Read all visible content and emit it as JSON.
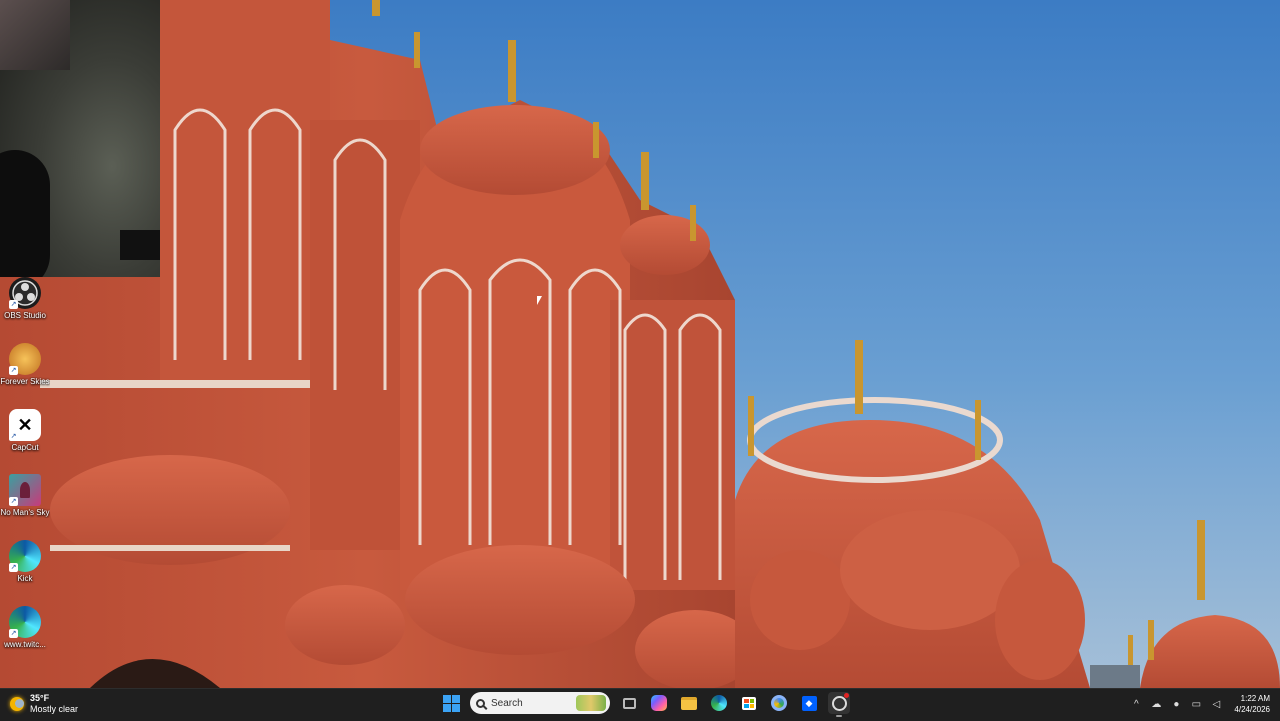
{
  "desktop": {
    "icons": [
      {
        "label": "OBS Studio",
        "icon": "obs-icon",
        "color": "#2b2b2b"
      },
      {
        "label": "Forever Skies",
        "icon": "forever-skies-icon",
        "color": "#e0a23a"
      },
      {
        "label": "CapCut",
        "icon": "capcut-icon",
        "color": "#ffffff"
      },
      {
        "label": "No Man's Sky",
        "icon": "no-mans-sky-icon",
        "color": "#c83a7a"
      },
      {
        "label": "Kick",
        "icon": "edge-kick-icon",
        "color": "#1e8fd8"
      },
      {
        "label": "www.twitc...",
        "icon": "edge-twitch-icon",
        "color": "#1e8fd8"
      }
    ]
  },
  "taskbar": {
    "weather": {
      "temp": "35°F",
      "condition": "Mostly clear"
    },
    "search_placeholder": "Search",
    "apps": [
      "task-view-icon",
      "copilot-icon",
      "file-explorer-icon",
      "edge-icon",
      "store-icon",
      "chrome-dev-icon",
      "dropbox-icon",
      "obs-icon"
    ],
    "clock": {
      "time": "1:22 AM",
      "date": "4/24/2026"
    }
  }
}
